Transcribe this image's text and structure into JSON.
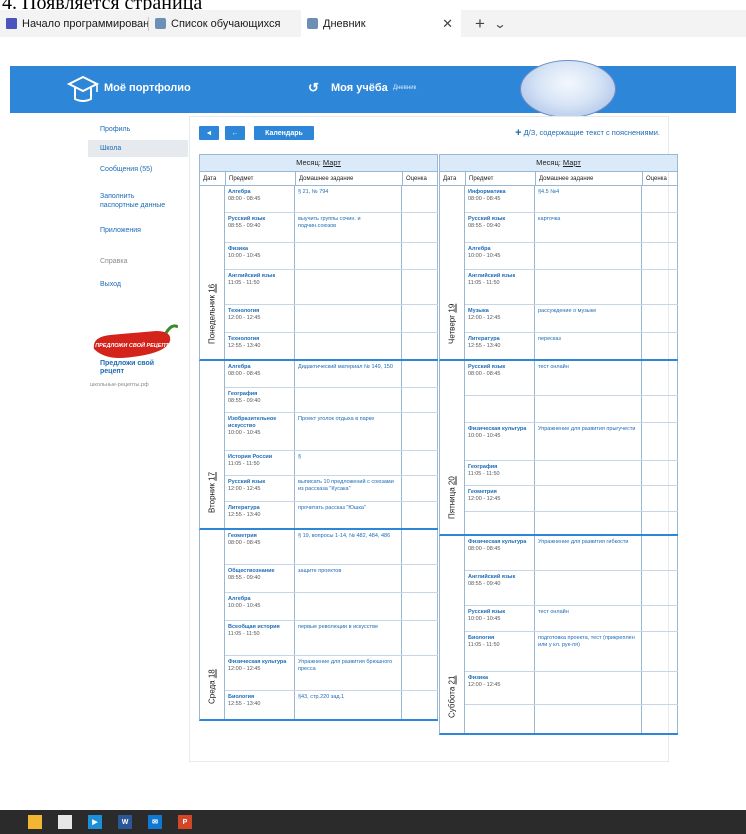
{
  "caption": "4. Появляется страница",
  "browser": {
    "tabs": [
      {
        "label": "Начало программировани",
        "icon": "forms-icon"
      },
      {
        "label": "Список обучающихся",
        "icon": "portfolio-icon"
      },
      {
        "label": "Дневник",
        "icon": "portfolio-icon",
        "active": true
      }
    ]
  },
  "header": {
    "logo": "Моё портфолио",
    "section": "Моя учёба",
    "subsection": "Дневник"
  },
  "sidebar": {
    "items": [
      {
        "label": "Профиль"
      },
      {
        "label": "Школа"
      },
      {
        "label": "Сообщения (55)"
      },
      {
        "label": "Заполнить паспортные данные"
      },
      {
        "label": "Приложения"
      },
      {
        "label": "Справка"
      },
      {
        "label": "Выход"
      }
    ],
    "pepper_text": "ПРЕДЛОЖИ СВОЙ РЕЦЕПТ",
    "recipe_title": "Предложи свой рецепт",
    "recipe_url": "школьные-рецепты.рф"
  },
  "toolbar": {
    "prev": "◄",
    "back": "←",
    "calendar": "Календарь",
    "hint": "Д/З, содержащие текст с пояснениями."
  },
  "columns": {
    "date": "Дата",
    "subject": "Предмет",
    "homework": "Домашнее задание",
    "grade": "Оценка"
  },
  "left": {
    "month_label": "Месяц:",
    "month": "Март",
    "days": [
      {
        "name": "Понедельник",
        "num": "16",
        "lessons": [
          {
            "subject": "Алгебра",
            "time": "08:00 - 08:45",
            "hw": "§ 21, № 794"
          },
          {
            "subject": "Русский язык",
            "time": "08:55 - 09:40",
            "hw": "выучить группы сочин. и подчин.союзов"
          },
          {
            "subject": "Физика",
            "time": "10:00 - 10:45",
            "hw": ""
          },
          {
            "subject": "Английский язык",
            "time": "11:05 - 11:50",
            "hw": ""
          },
          {
            "subject": "Технология",
            "time": "12:00 - 12:45",
            "hw": ""
          },
          {
            "subject": "Технология",
            "time": "12:55 - 13:40",
            "hw": ""
          }
        ]
      },
      {
        "name": "Вторник",
        "num": "17",
        "lessons": [
          {
            "subject": "Алгебра",
            "time": "08:00 - 08:45",
            "hw": "Дидактический материал № 149, 150"
          },
          {
            "subject": "География",
            "time": "08:55 - 09:40",
            "hw": ""
          },
          {
            "subject": "Изобразительное искусство",
            "time": "10:00 - 10:45",
            "hw": "Проект уголок отдыха в парке"
          },
          {
            "subject": "История России",
            "time": "11:05 - 11:50",
            "hw": "§"
          },
          {
            "subject": "Русский язык",
            "time": "12:00 - 12:45",
            "hw": "выписать 10 предложений с союзами из рассказа \"Кусака\""
          },
          {
            "subject": "Литература",
            "time": "12:55 - 13:40",
            "hw": "прочитать рассказ \"Юшка\""
          }
        ]
      },
      {
        "name": "Среда",
        "num": "18",
        "lessons": [
          {
            "subject": "Геометрия",
            "time": "08:00 - 08:45",
            "hw": "§ 19, вопросы 1-14, № 482, 484, 486"
          },
          {
            "subject": "Обществознание",
            "time": "08:55 - 09:40",
            "hw": "защите проектов"
          },
          {
            "subject": "Алгебра",
            "time": "10:00 - 10:45",
            "hw": ""
          },
          {
            "subject": "Всеобщая история",
            "time": "11:05 - 11:50",
            "hw": "первые революции в искусстве"
          },
          {
            "subject": "Физическая культура",
            "time": "12:00 - 12:45",
            "hw": "Упражнение для развития брюшного пресса"
          },
          {
            "subject": "Биология",
            "time": "12:55 - 13:40",
            "hw": "§43, стр.220 зад.1"
          }
        ]
      }
    ]
  },
  "right": {
    "month_label": "Месяц:",
    "month": "Март",
    "days": [
      {
        "name": "Четверг",
        "num": "19",
        "lessons": [
          {
            "subject": "Информатика",
            "time": "08:00 - 08:45",
            "hw": "§4.5 №4"
          },
          {
            "subject": "Русский язык",
            "time": "08:55 - 09:40",
            "hw": "карточка"
          },
          {
            "subject": "Алгебра",
            "time": "10:00 - 10:45",
            "hw": ""
          },
          {
            "subject": "Английский язык",
            "time": "11:05 - 11:50",
            "hw": ""
          },
          {
            "subject": "Музыка",
            "time": "12:00 - 12:45",
            "hw": "рассуждение о музыке"
          },
          {
            "subject": "Литература",
            "time": "12:55 - 13:40",
            "hw": "пересказ"
          }
        ]
      },
      {
        "name": "Пятница",
        "num": "20",
        "lessons": [
          {
            "subject": "Русский язык",
            "time": "08:00 - 08:45",
            "hw": "тест онлайн"
          },
          {
            "subject": "",
            "time": "",
            "hw": ""
          },
          {
            "subject": "Физическая культура",
            "time": "10:00 - 10:45",
            "hw": "Упражнение для развития прыгучести"
          },
          {
            "subject": "География",
            "time": "11:05 - 11:50",
            "hw": ""
          },
          {
            "subject": "Геометрия",
            "time": "12:00 - 12:45",
            "hw": ""
          },
          {
            "subject": "",
            "time": "",
            "hw": ""
          }
        ]
      },
      {
        "name": "Суббота",
        "num": "21",
        "lessons": [
          {
            "subject": "Физическая культура",
            "time": "08:00 - 08:45",
            "hw": "Упражнение для развития гибкости"
          },
          {
            "subject": "Английский язык",
            "time": "08:55 - 09:40",
            "hw": ""
          },
          {
            "subject": "Русский язык",
            "time": "10:00 - 10:45",
            "hw": "тест онлайн"
          },
          {
            "subject": "Биология",
            "time": "11:05 - 11:50",
            "hw": "подготовка проекта, тест (прикреплен или у кл. рук-ля)"
          },
          {
            "subject": "Физика",
            "time": "12:00 - 12:45",
            "hw": ""
          },
          {
            "subject": "",
            "time": "",
            "hw": ""
          }
        ]
      }
    ]
  },
  "taskbar": {
    "apps": [
      "file-explorer-icon",
      "store-icon",
      "media-player-icon",
      "word-icon",
      "mail-icon",
      "powerpoint-icon"
    ]
  }
}
